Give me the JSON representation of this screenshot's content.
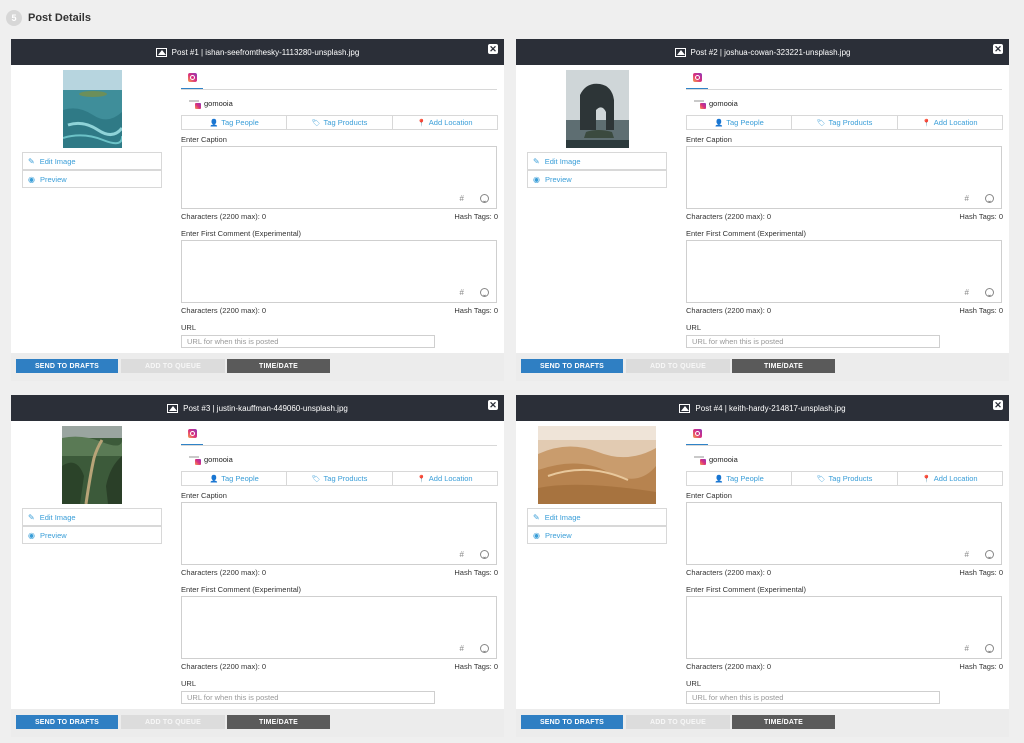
{
  "step": {
    "number": "5",
    "title": "Post Details"
  },
  "labels": {
    "edit_image": "Edit Image",
    "preview": "Preview",
    "tag_people": "Tag People",
    "tag_products": "Tag Products",
    "add_location": "Add Location",
    "enter_caption": "Enter Caption",
    "enter_first_comment": "Enter First Comment (Experimental)",
    "characters": "Characters (2200 max): 0",
    "hash_tags": "Hash Tags: 0",
    "url": "URL",
    "url_placeholder": "URL for when this is posted",
    "hash_symbol": "#",
    "send_to_drafts": "SEND TO DRAFTS",
    "add_to_queue": "ADD TO QUEUE",
    "time_date": "TIME/DATE"
  },
  "posts": [
    {
      "title": "Post #1 | ishan-seefromthesky-1113280-unsplash.jpg",
      "account": "gomooia",
      "image": "ocean-island-icon"
    },
    {
      "title": "Post #2 | joshua-cowan-323221-unsplash.jpg",
      "account": "gomooia",
      "image": "sea-arch-icon"
    },
    {
      "title": "Post #3 | justin-kauffman-449060-unsplash.jpg",
      "account": "gomooia",
      "image": "mountain-trail-icon"
    },
    {
      "title": "Post #4 | keith-hardy-214817-unsplash.jpg",
      "account": "gomooia",
      "image": "desert-dunes-icon"
    }
  ],
  "colors": {
    "header_bg": "#2b2f38",
    "accent_blue": "#2f7fc3",
    "link_blue": "#3a9ed8",
    "time_button": "#5a5a5a"
  }
}
